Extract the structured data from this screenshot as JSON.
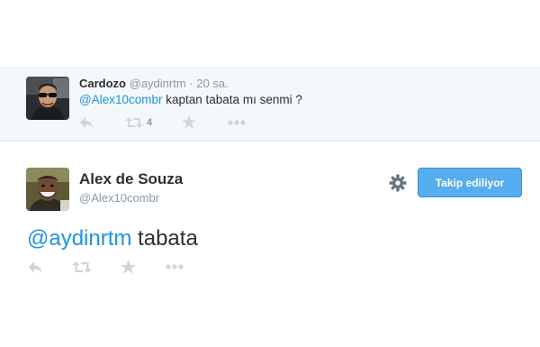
{
  "reply_tweet": {
    "fullname": "Cardozo",
    "handle": "@aydinrtm",
    "separator": "·",
    "time": "20 sa.",
    "mention": "@Alex10combr",
    "text": " kaptan tabata mı senmi ?",
    "retweet_count": "4",
    "avatar_icon": "user-photo-sunglasses",
    "actions": [
      "reply-icon",
      "retweet-icon",
      "favorite-icon",
      "more-icon"
    ]
  },
  "main_tweet": {
    "fullname": "Alex de Souza",
    "handle": "@Alex10combr",
    "follow_button_label": "Takip ediliyor",
    "mention": "@aydinrtm",
    "text": " tabata",
    "avatar_icon": "user-photo-smiling",
    "settings_icon": "gear-icon",
    "actions": [
      "reply-icon",
      "retweet-icon",
      "favorite-icon",
      "more-icon"
    ]
  },
  "colors": {
    "link": "#1b95e0",
    "button": "#55acee",
    "muted": "#8899a6",
    "icon": "#ccd6dd",
    "reply_background": "#f5f8fa"
  }
}
